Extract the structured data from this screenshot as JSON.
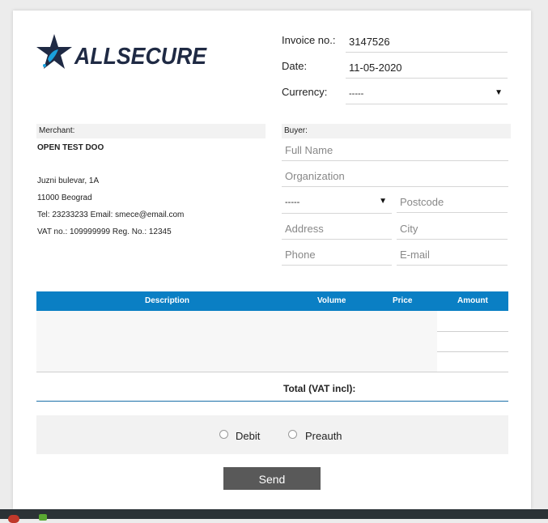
{
  "brand": {
    "name": "ALLSECURE",
    "logo_color": "#1f2a44",
    "accent": "#1aa0dc"
  },
  "invoice": {
    "invoice_no_label": "Invoice no.:",
    "invoice_no": "3147526",
    "date_label": "Date:",
    "date": "11-05-2020",
    "currency_label": "Currency:",
    "currency_value": "-----"
  },
  "merchant": {
    "heading": "Merchant:",
    "name": "OPEN TEST DOO",
    "street": "Juzni bulevar, 1A",
    "city": "11000 Beograd",
    "contact": "Tel: 23233233  Email: smece@email.com",
    "vat": "VAT no.: 109999999  Reg. No.: 12345"
  },
  "buyer": {
    "heading": "Buyer:",
    "full_name_placeholder": "Full Name",
    "organization_placeholder": "Organization",
    "country_value": "-----",
    "postcode_placeholder": "Postcode",
    "address_placeholder": "Address",
    "city_placeholder": "City",
    "phone_placeholder": "Phone",
    "email_placeholder": "E-mail"
  },
  "table": {
    "columns": [
      "Description",
      "Volume",
      "Price",
      "Amount"
    ],
    "header_color": "#0a7fc4",
    "rows": [
      {},
      {},
      {}
    ]
  },
  "total_label": "Total (VAT incl):",
  "payment": {
    "debit_label": "Debit",
    "preauth_label": "Preauth"
  },
  "send_label": "Send"
}
